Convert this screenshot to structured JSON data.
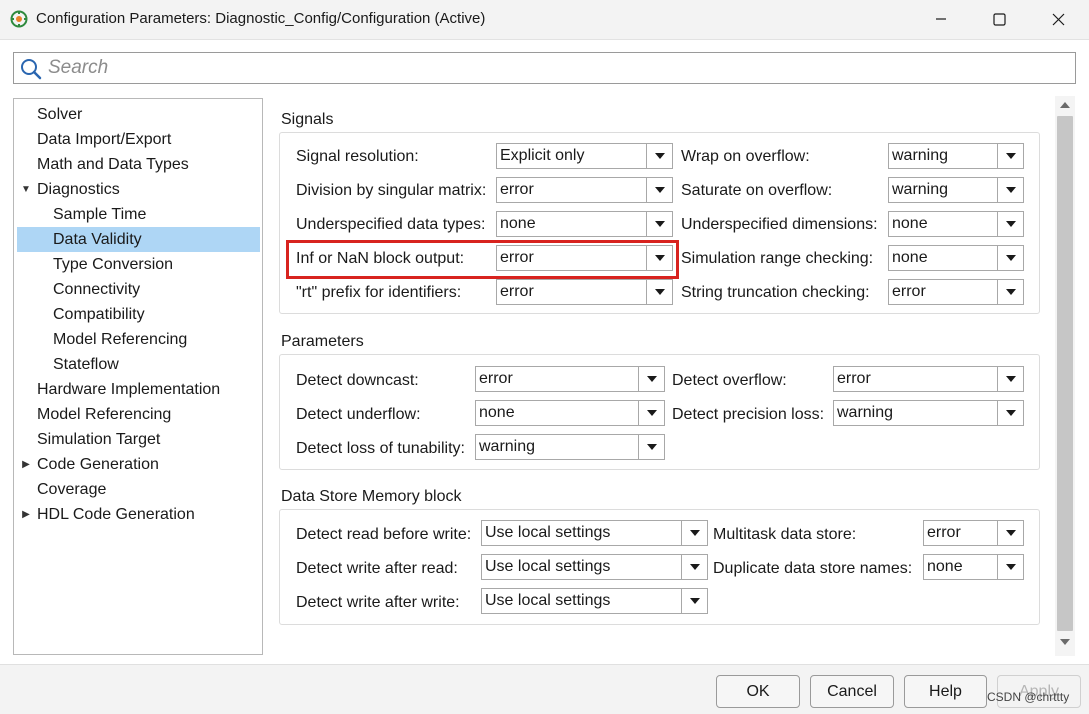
{
  "window": {
    "title": "Configuration Parameters: Diagnostic_Config/Configuration (Active)",
    "minimize_icon": "minimize-icon",
    "maximize_icon": "maximize-icon",
    "close_icon": "close-icon"
  },
  "search": {
    "placeholder": "Search",
    "value": ""
  },
  "tree": {
    "items": [
      {
        "label": "Solver",
        "level": 0,
        "expander": ""
      },
      {
        "label": "Data Import/Export",
        "level": 0,
        "expander": ""
      },
      {
        "label": "Math and Data Types",
        "level": 0,
        "expander": ""
      },
      {
        "label": "Diagnostics",
        "level": 0,
        "expander": "expanded"
      },
      {
        "label": "Sample Time",
        "level": 1,
        "expander": ""
      },
      {
        "label": "Data Validity",
        "level": 1,
        "expander": "",
        "selected": true
      },
      {
        "label": "Type Conversion",
        "level": 1,
        "expander": ""
      },
      {
        "label": "Connectivity",
        "level": 1,
        "expander": ""
      },
      {
        "label": "Compatibility",
        "level": 1,
        "expander": ""
      },
      {
        "label": "Model Referencing",
        "level": 1,
        "expander": ""
      },
      {
        "label": "Stateflow",
        "level": 1,
        "expander": ""
      },
      {
        "label": "Hardware Implementation",
        "level": 0,
        "expander": ""
      },
      {
        "label": "Model Referencing",
        "level": 0,
        "expander": ""
      },
      {
        "label": "Simulation Target",
        "level": 0,
        "expander": ""
      },
      {
        "label": "Code Generation",
        "level": 0,
        "expander": "collapsed"
      },
      {
        "label": "Coverage",
        "level": 0,
        "expander": ""
      },
      {
        "label": "HDL Code Generation",
        "level": 0,
        "expander": "collapsed"
      }
    ]
  },
  "signals": {
    "title": "Signals",
    "signal_resolution": {
      "label": "Signal resolution:",
      "value": "Explicit only"
    },
    "division_by_singular_matrix": {
      "label": "Division by singular matrix:",
      "value": "error"
    },
    "underspecified_data_types": {
      "label": "Underspecified data types:",
      "value": "none"
    },
    "inf_or_nan_block_output": {
      "label": "Inf or NaN block output:",
      "value": "error"
    },
    "rt_prefix": {
      "label": "\"rt\" prefix for identifiers:",
      "value": "error"
    },
    "wrap_on_overflow": {
      "label": "Wrap on overflow:",
      "value": "warning"
    },
    "saturate_on_overflow": {
      "label": "Saturate on overflow:",
      "value": "warning"
    },
    "underspecified_dimensions": {
      "label": "Underspecified dimensions:",
      "value": "none"
    },
    "simulation_range_checking": {
      "label": "Simulation range checking:",
      "value": "none"
    },
    "string_truncation_checking": {
      "label": "String truncation checking:",
      "value": "error"
    }
  },
  "parameters": {
    "title": "Parameters",
    "detect_downcast": {
      "label": "Detect downcast:",
      "value": "error"
    },
    "detect_underflow": {
      "label": "Detect underflow:",
      "value": "none"
    },
    "detect_loss_of_tunability": {
      "label": "Detect loss of tunability:",
      "value": "warning"
    },
    "detect_overflow": {
      "label": "Detect overflow:",
      "value": "error"
    },
    "detect_precision_loss": {
      "label": "Detect precision loss:",
      "value": "warning"
    }
  },
  "data_store": {
    "title": "Data Store Memory block",
    "detect_read_before_write": {
      "label": "Detect read before write:",
      "value": "Use local settings"
    },
    "detect_write_after_read": {
      "label": "Detect write after read:",
      "value": "Use local settings"
    },
    "detect_write_after_write": {
      "label": "Detect write after write:",
      "value": "Use local settings"
    },
    "multitask_data_store": {
      "label": "Multitask data store:",
      "value": "error"
    },
    "duplicate_data_store_names": {
      "label": "Duplicate data store names:",
      "value": "none"
    }
  },
  "footer": {
    "ok": "OK",
    "cancel": "Cancel",
    "help": "Help",
    "apply": "Apply",
    "watermark": "CSDN @chrttty"
  },
  "colors": {
    "selection": "#aed6f5",
    "highlight_border": "#d8231f",
    "title_bar": "#f3f3f3"
  }
}
